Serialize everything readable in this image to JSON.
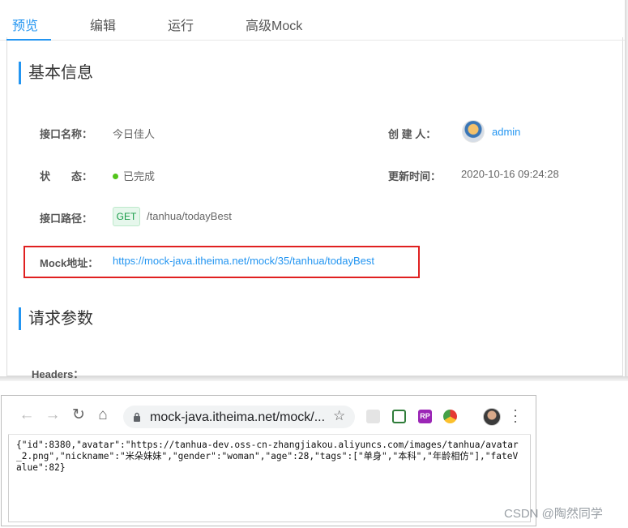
{
  "tabs": [
    {
      "label": "预览",
      "active": true
    },
    {
      "label": "编辑",
      "active": false
    },
    {
      "label": "运行",
      "active": false
    },
    {
      "label": "高级Mock",
      "active": false
    }
  ],
  "basic_info": {
    "title": "基本信息",
    "fields": {
      "name_label": "接口名称：",
      "name_value": "今日佳人",
      "creator_label": "创 建 人：",
      "creator_value": "admin",
      "status_label": "状　　态：",
      "status_value": "已完成",
      "updated_label": "更新时间：",
      "updated_value": "2020-10-16 09:24:28",
      "path_label": "接口路径：",
      "method": "GET",
      "path_value": "/tanhua/todayBest",
      "mock_label": "Mock地址：",
      "mock_url": "https://mock-java.itheima.net/mock/35/tanhua/todayBest"
    }
  },
  "request_params": {
    "title": "请求参数",
    "headers_label": "Headers："
  },
  "colors": {
    "accent": "#2395f1",
    "status_done": "#52c41a",
    "highlight_box": "#e02020"
  },
  "browser": {
    "back_icon": "←",
    "forward_icon": "→",
    "reload_icon": "↻",
    "home_icon": "⌂",
    "address": "mock-java.itheima.net/mock/...",
    "star_icon": "☆",
    "body_text": "{\"id\":8380,\"avatar\":\"https://tanhua-dev.oss-cn-zhangjiakou.aliyuncs.com/images/tanhua/avatar_2.png\",\"nickname\":\"米朵妹妹\",\"gender\":\"woman\",\"age\":28,\"tags\":[\"单身\",\"本科\",\"年龄相仿\"],\"fateValue\":82}",
    "ext_rp_label": "RP"
  },
  "watermark": "CSDN @陶然同学"
}
